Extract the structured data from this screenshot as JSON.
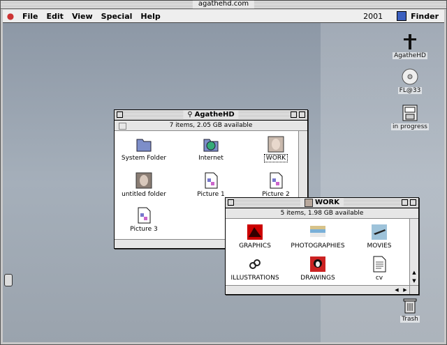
{
  "window_title": "agathehd.com",
  "menu": [
    "File",
    "Edit",
    "View",
    "Special",
    "Help"
  ],
  "menu_right": {
    "year": "2001",
    "app": "Finder"
  },
  "desktop_icons": [
    {
      "label": "AgatheHD"
    },
    {
      "label": "FL@33"
    },
    {
      "label": "in progress"
    },
    {
      "label": "Trash"
    }
  ],
  "agathe_window": {
    "title": "AgatheHD",
    "info": "7 items, 2.05 GB available",
    "items": [
      "System Folder",
      "Internet",
      "WORK",
      "untitled folder",
      "Picture 1",
      "Picture 2",
      "Picture 3"
    ]
  },
  "work_window": {
    "title": "WORK",
    "info": "5 items, 1.98 GB available",
    "items": [
      "GRAPHICS",
      "PHOTOGRAPHIES",
      "MOVIES",
      "ILLUSTRATIONS",
      "DRAWINGS",
      "cv"
    ]
  },
  "colors": {
    "desktop": "#9aa3ad",
    "menubar": "#eeeeee"
  }
}
